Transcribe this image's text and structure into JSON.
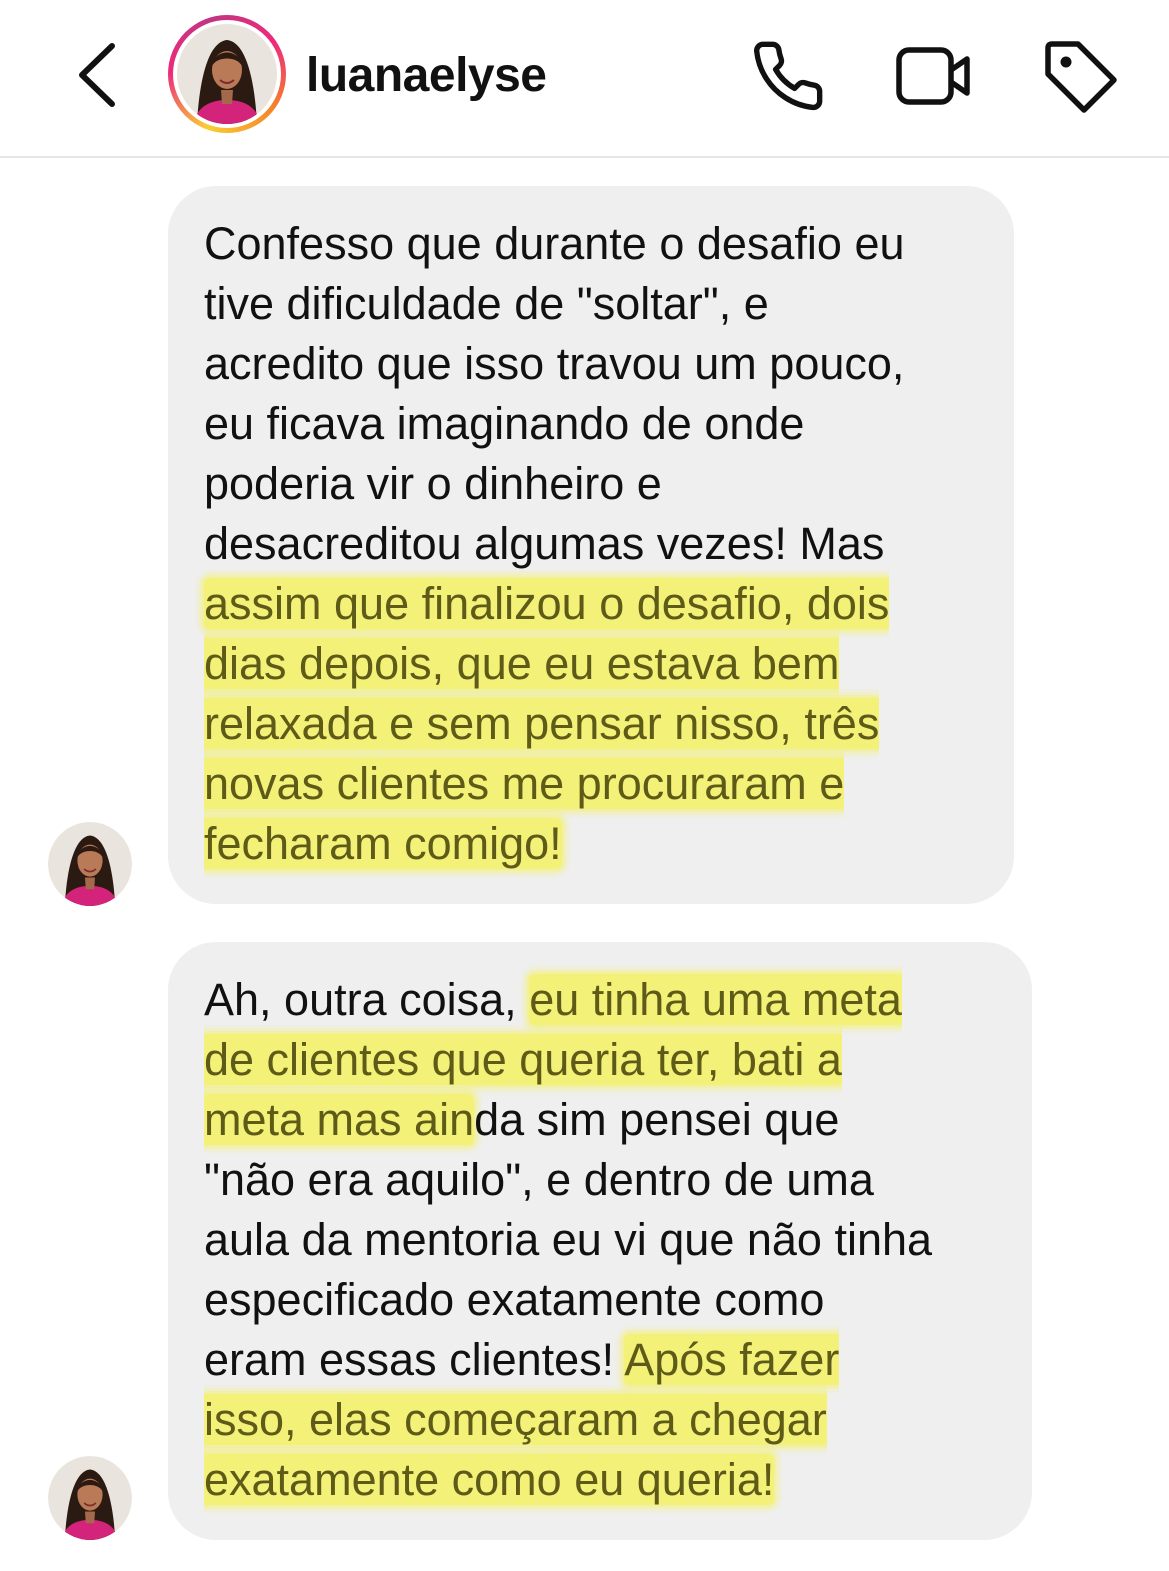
{
  "header": {
    "username": "luanaelyse",
    "icons": {
      "back": "chevron-left-icon",
      "call": "phone-icon",
      "video": "video-camera-icon",
      "tag": "tag-icon"
    }
  },
  "colors": {
    "bubble_background": "#efefef",
    "highlight": "#f6f22e",
    "text": "#111111",
    "story_ring": [
      "#f9ce34",
      "#ee2a7b",
      "#c13584"
    ]
  },
  "messages": [
    {
      "sender": "luanaelyse",
      "segments": [
        {
          "text": "Confesso que durante o desafio eu\ntive dificuldade de \"soltar\", e\nacredito que isso travou um pouco,\neu ficava imaginando de onde\npoderia vir o dinheiro e\ndesacreditou algumas vezes! Mas\n",
          "highlighted": false
        },
        {
          "text": "assim que finalizou o desafio, dois\ndias depois, que eu estava bem\nrelaxada e sem pensar nisso, três\nnovas clientes me procuraram e\nfecharam comigo!",
          "highlighted": true
        }
      ]
    },
    {
      "sender": "luanaelyse",
      "segments": [
        {
          "text": "Ah, outra coisa, ",
          "highlighted": false
        },
        {
          "text": "eu tinha uma meta\nde clientes que queria ter, bati a\nmeta mas ain",
          "highlighted": true
        },
        {
          "text": "da sim pensei que\n\"não era aquilo\", e dentro de uma\naula da mentoria eu vi que não tinha\nespecificado exatamente como\neram essas clientes! ",
          "highlighted": false
        },
        {
          "text": "Após fazer\nisso, elas começaram a chegar\nexatamente como eu queria!",
          "highlighted": true
        }
      ]
    }
  ]
}
